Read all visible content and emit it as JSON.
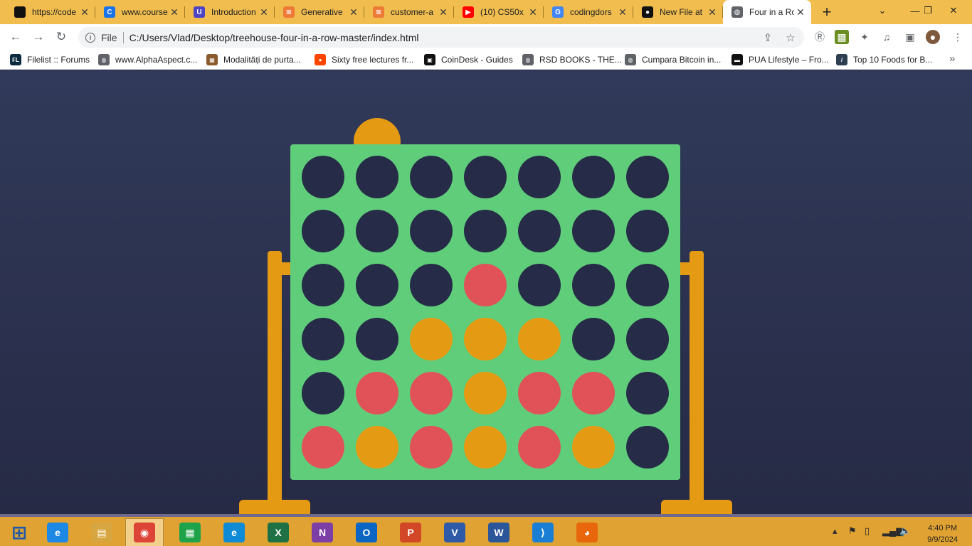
{
  "browser": {
    "tabs": [
      {
        "title": "https://code",
        "icon": "square-logo-icon",
        "color": "#111111",
        "glyph": "",
        "active": false
      },
      {
        "title": "www.courses",
        "icon": "c-logo-icon",
        "color": "#1a73e8",
        "glyph": "C",
        "active": false
      },
      {
        "title": "Introduction",
        "icon": "udacity-icon",
        "color": "#4d45c2",
        "glyph": "U",
        "active": false
      },
      {
        "title": "Generative",
        "icon": "layers-icon",
        "color": "#ee7a38",
        "glyph": "≋",
        "active": false
      },
      {
        "title": "customer-a",
        "icon": "layers-icon",
        "color": "#ee7a38",
        "glyph": "≋",
        "active": false
      },
      {
        "title": "(10) CS50x",
        "icon": "youtube-icon",
        "color": "#ff0000",
        "glyph": "▶",
        "active": false
      },
      {
        "title": "codingdors",
        "icon": "google-icon",
        "color": "#4285f4",
        "glyph": "G",
        "active": false
      },
      {
        "title": "New File at",
        "icon": "github-icon",
        "color": "#111111",
        "glyph": "●",
        "active": false
      },
      {
        "title": "Four in a Ro",
        "icon": "globe-icon",
        "color": "#5f6368",
        "glyph": "◍",
        "active": true
      }
    ],
    "address": {
      "scheme": "File",
      "url": "C:/Users/Vlad/Desktop/treehouse-four-in-a-row-master/index.html"
    },
    "bookmarks": [
      {
        "label": "Filelist :: Forums",
        "icon": "filelist-icon",
        "color": "#0d2b3e",
        "glyph": "FL"
      },
      {
        "label": "www.AlphaAspect.c...",
        "icon": "globe-icon",
        "color": "#5f6368",
        "glyph": "◍"
      },
      {
        "label": "Modalități de purta...",
        "icon": "site-icon",
        "color": "#8a5a2b",
        "glyph": "▦"
      },
      {
        "label": "Sixty free lectures fr...",
        "icon": "reddit-icon",
        "color": "#ff4500",
        "glyph": "●"
      },
      {
        "label": "CoinDesk - Guides",
        "icon": "coindesk-icon",
        "color": "#111111",
        "glyph": "▣"
      },
      {
        "label": "RSD BOOKS - THE...",
        "icon": "globe-icon",
        "color": "#5f6368",
        "glyph": "◍"
      },
      {
        "label": "Cumpara Bitcoin in...",
        "icon": "globe-icon",
        "color": "#5f6368",
        "glyph": "◍"
      },
      {
        "label": "PUA Lifestyle – Fro...",
        "icon": "pua-icon",
        "color": "#111111",
        "glyph": "▬"
      },
      {
        "label": "Top 10 Foods for B...",
        "icon": "site-icon",
        "color": "#2c3e50",
        "glyph": "/"
      }
    ]
  },
  "game": {
    "board_color": "#5fcd7a",
    "empty_color": "#262b47",
    "red_color": "#e15258",
    "yellow_color": "#e59a13",
    "background": "#2a2f48",
    "pending_disc": "yellow",
    "pending_column": 2,
    "rows": [
      [
        "empty",
        "empty",
        "empty",
        "empty",
        "empty",
        "empty",
        "empty"
      ],
      [
        "empty",
        "empty",
        "empty",
        "empty",
        "empty",
        "empty",
        "empty"
      ],
      [
        "empty",
        "empty",
        "empty",
        "red",
        "empty",
        "empty",
        "empty"
      ],
      [
        "empty",
        "empty",
        "yellow",
        "yellow",
        "yellow",
        "empty",
        "empty"
      ],
      [
        "empty",
        "red",
        "red",
        "yellow",
        "red",
        "red",
        "empty"
      ],
      [
        "red",
        "yellow",
        "red",
        "yellow",
        "red",
        "yellow",
        "empty"
      ]
    ]
  },
  "taskbar": {
    "apps": [
      {
        "name": "start-button",
        "icon": "windows-icon",
        "color": "transparent",
        "glyph": "⊞"
      },
      {
        "name": "ie",
        "icon": "internet-explorer-icon",
        "color": "#1e88e5",
        "glyph": "e"
      },
      {
        "name": "explorer",
        "icon": "file-explorer-icon",
        "color": "#d8a640",
        "glyph": "▤"
      },
      {
        "name": "chrome",
        "icon": "chrome-icon",
        "color": "#db4437",
        "glyph": "◉"
      },
      {
        "name": "store",
        "icon": "store-icon",
        "color": "#1ea34a",
        "glyph": "▦"
      },
      {
        "name": "edge",
        "icon": "edge-icon",
        "color": "#0f8bd6",
        "glyph": "e"
      },
      {
        "name": "excel",
        "icon": "excel-icon",
        "color": "#1e7145",
        "glyph": "X"
      },
      {
        "name": "onenote",
        "icon": "onenote-icon",
        "color": "#7b3fa6",
        "glyph": "N"
      },
      {
        "name": "outlook",
        "icon": "outlook-icon",
        "color": "#0a66c2",
        "glyph": "O"
      },
      {
        "name": "powerpoint",
        "icon": "powerpoint-icon",
        "color": "#d24726",
        "glyph": "P"
      },
      {
        "name": "visio",
        "icon": "visio-icon",
        "color": "#2f5aa8",
        "glyph": "V"
      },
      {
        "name": "word",
        "icon": "word-icon",
        "color": "#2b579a",
        "glyph": "W"
      },
      {
        "name": "vscode",
        "icon": "vscode-icon",
        "color": "#1a7fd4",
        "glyph": "⟩"
      },
      {
        "name": "firefox",
        "icon": "firefox-icon",
        "color": "#e8670c",
        "glyph": "◕"
      }
    ],
    "time": "4:40 PM",
    "date": "9/9/2024"
  }
}
